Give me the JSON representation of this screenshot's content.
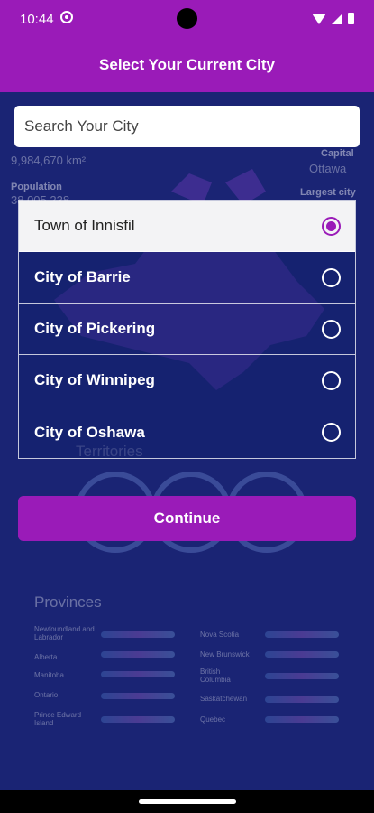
{
  "status_bar": {
    "time": "10:44",
    "icons": [
      "settings-icon",
      "wifi-icon",
      "signal-icon",
      "battery-icon"
    ]
  },
  "app_bar": {
    "title": "Select Your Current City"
  },
  "search": {
    "placeholder": "Search Your City",
    "value": ""
  },
  "background": {
    "area_value": "9,984,670 km²",
    "population_label": "Population",
    "population_value": "38,005,238",
    "capital_label": "Capital",
    "capital_value": "Ottawa",
    "largest_city_label": "Largest city",
    "territories_label": "Territories",
    "provinces_title": "Provinces",
    "provinces_left": [
      "Newfoundland and Labrador",
      "Alberta",
      "Manitoba",
      "Ontario",
      "Prince Edward Island"
    ],
    "provinces_right": [
      "Nova Scotia",
      "New Brunswick",
      "British Columbia",
      "Saskatchewan",
      "Quebec"
    ]
  },
  "cities": [
    {
      "label": "Town of Innisfil",
      "selected": true
    },
    {
      "label": "City of Barrie",
      "selected": false
    },
    {
      "label": "City of Pickering",
      "selected": false
    },
    {
      "label": "City of Winnipeg",
      "selected": false
    },
    {
      "label": "City of Oshawa",
      "selected": false
    }
  ],
  "continue_label": "Continue",
  "colors": {
    "primary": "#9a1bb8",
    "background": "#1a2474",
    "selected_row": "#f3f3f5"
  }
}
